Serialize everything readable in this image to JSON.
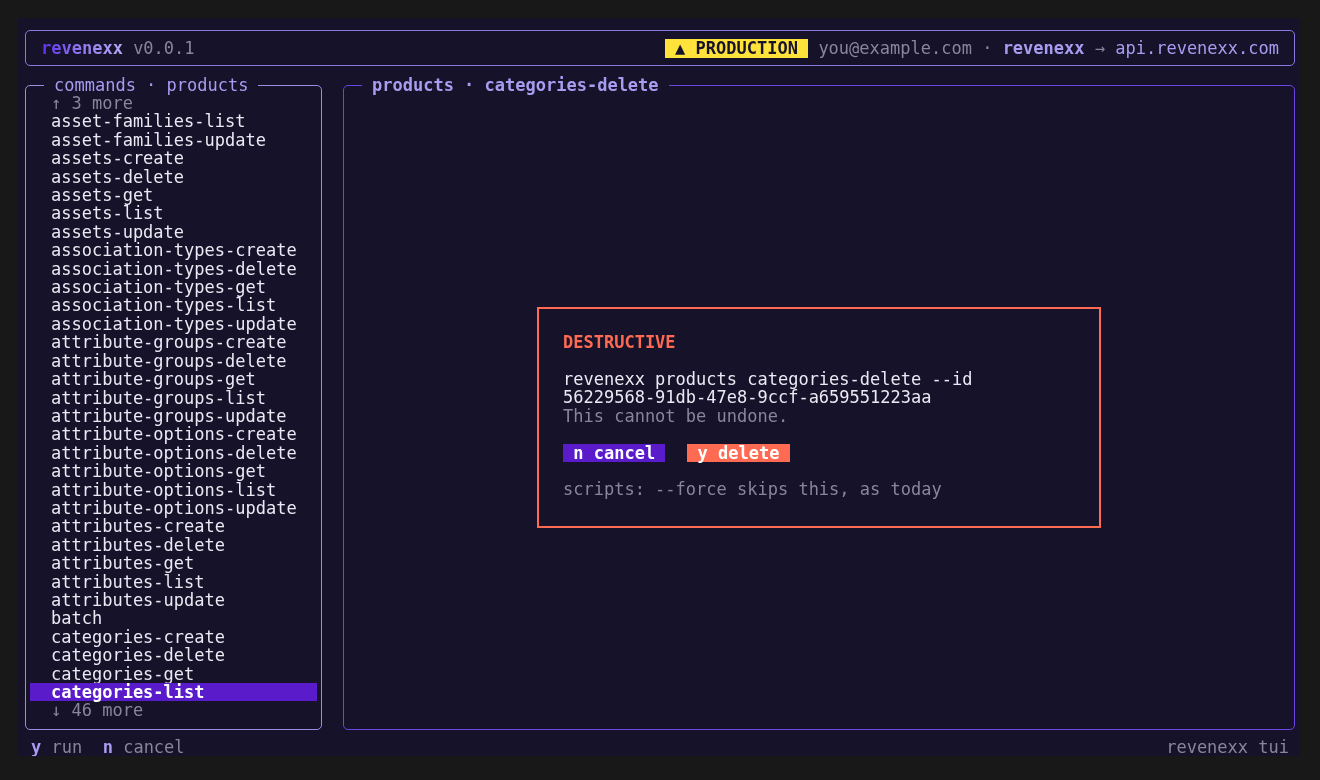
{
  "header": {
    "app_name": "revenexx",
    "version": "v0.0.1",
    "environment_badge": "▲ PRODUCTION",
    "user": "you@example.com",
    "separator": "·",
    "profile": "revenexx",
    "arrow": "→",
    "host": "api.revenexx.com"
  },
  "commands_panel": {
    "title": "commands · products",
    "more_above": "↑ 3 more",
    "items": [
      {
        "label": "asset-families-list",
        "selected": false
      },
      {
        "label": "asset-families-update",
        "selected": false
      },
      {
        "label": "assets-create",
        "selected": false
      },
      {
        "label": "assets-delete",
        "selected": false
      },
      {
        "label": "assets-get",
        "selected": false
      },
      {
        "label": "assets-list",
        "selected": false
      },
      {
        "label": "assets-update",
        "selected": false
      },
      {
        "label": "association-types-create",
        "selected": false
      },
      {
        "label": "association-types-delete",
        "selected": false
      },
      {
        "label": "association-types-get",
        "selected": false
      },
      {
        "label": "association-types-list",
        "selected": false
      },
      {
        "label": "association-types-update",
        "selected": false
      },
      {
        "label": "attribute-groups-create",
        "selected": false
      },
      {
        "label": "attribute-groups-delete",
        "selected": false
      },
      {
        "label": "attribute-groups-get",
        "selected": false
      },
      {
        "label": "attribute-groups-list",
        "selected": false
      },
      {
        "label": "attribute-groups-update",
        "selected": false
      },
      {
        "label": "attribute-options-create",
        "selected": false
      },
      {
        "label": "attribute-options-delete",
        "selected": false
      },
      {
        "label": "attribute-options-get",
        "selected": false
      },
      {
        "label": "attribute-options-list",
        "selected": false
      },
      {
        "label": "attribute-options-update",
        "selected": false
      },
      {
        "label": "attributes-create",
        "selected": false
      },
      {
        "label": "attributes-delete",
        "selected": false
      },
      {
        "label": "attributes-get",
        "selected": false
      },
      {
        "label": "attributes-list",
        "selected": false
      },
      {
        "label": "attributes-update",
        "selected": false
      },
      {
        "label": "batch",
        "selected": false
      },
      {
        "label": "categories-create",
        "selected": false
      },
      {
        "label": "categories-delete",
        "selected": false
      },
      {
        "label": "categories-get",
        "selected": false
      },
      {
        "label": "categories-list",
        "selected": true
      }
    ],
    "more_below": "↓ 46 more"
  },
  "detail_panel": {
    "title": "products · categories-delete",
    "dialog": {
      "heading": "DESTRUCTIVE",
      "command": "revenexx products categories-delete --id 56229568-91db-47e8-9ccf-a659551223aa",
      "warning": "This cannot be undone.",
      "buttons": [
        {
          "label": "n cancel",
          "kind": "cancel"
        },
        {
          "label": "y delete",
          "kind": "danger"
        }
      ],
      "note": "scripts: --force skips this, as today"
    }
  },
  "footer": {
    "shortcuts": [
      {
        "key": "y",
        "label": "run"
      },
      {
        "key": "n",
        "label": "cancel"
      }
    ],
    "app_label": "revenexx tui"
  }
}
